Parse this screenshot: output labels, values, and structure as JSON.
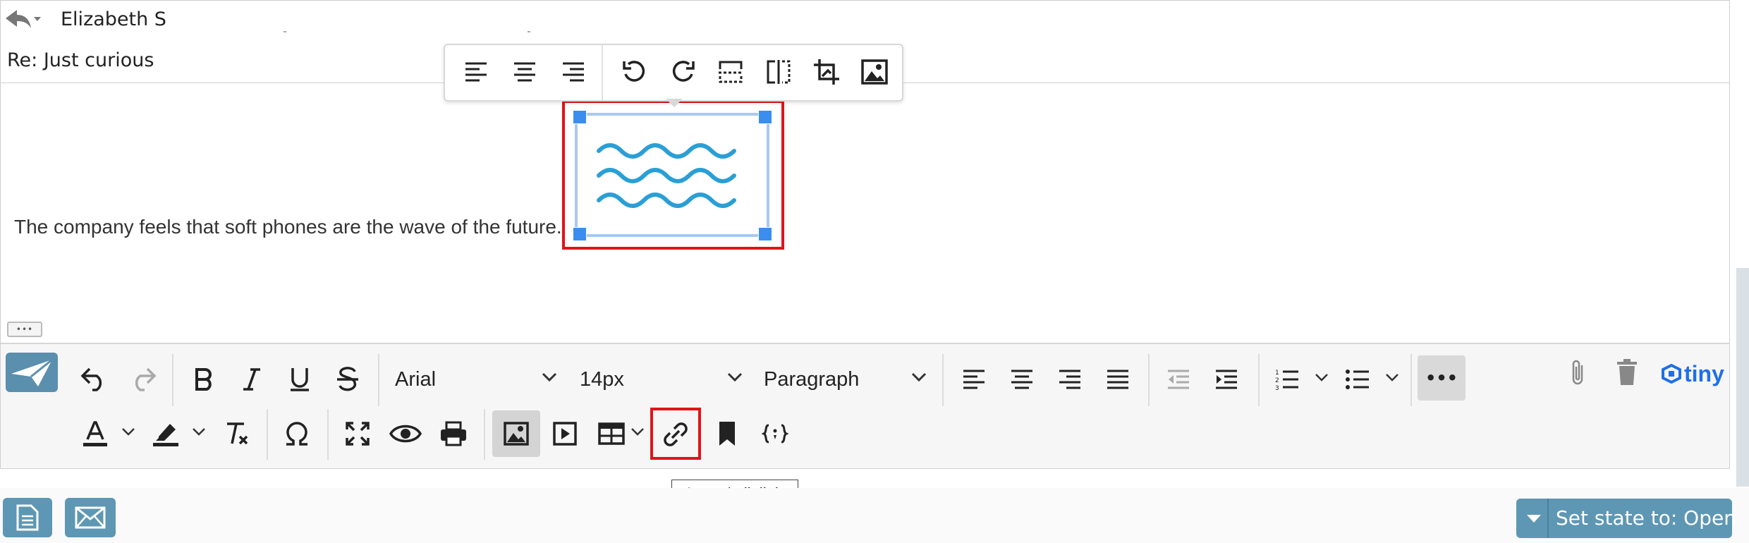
{
  "header": {
    "recipient": "Elizabeth S",
    "subject": "Re: Just curious"
  },
  "body": {
    "text": "The company feels that soft phones are the wave of the future."
  },
  "image_toolbar": {
    "buttons": [
      "align-left",
      "align-center",
      "align-right",
      "rotate-left",
      "rotate-right",
      "flip-vertical",
      "flip-horizontal",
      "crop",
      "image-options"
    ]
  },
  "toolbar": {
    "font_family": "Arial",
    "font_size": "14px",
    "block_format": "Paragraph",
    "brand": "tiny",
    "more_label": "•••"
  },
  "tooltip": {
    "text": "Insert/edit link"
  },
  "footer": {
    "state_label": "Set state to: Open"
  },
  "colors": {
    "accent": "#5e97b4",
    "highlight_red": "#e0141a",
    "tiny_blue": "#1f6fe8",
    "handle_blue": "#3a8ef0"
  }
}
